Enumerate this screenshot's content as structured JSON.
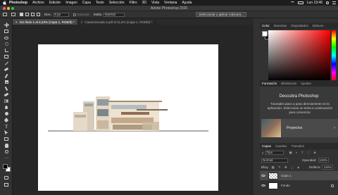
{
  "menubar": {
    "app": "Photoshop",
    "items": [
      "Archivo",
      "Edición",
      "Imagen",
      "Capa",
      "Texto",
      "Selección",
      "Filtro",
      "3D",
      "Vista",
      "Ventana",
      "Ayuda"
    ],
    "clock": "Lun 13:46"
  },
  "window": {
    "title": "Adobe Photoshop 2020"
  },
  "options": {
    "feather_label": "Des.:",
    "feather_value": "0 px",
    "antialias_label": "Suavizar",
    "style_label": "Estilo:",
    "style_value": "Normal",
    "select_mask_button": "Seleccionar y aplicar máscara..."
  },
  "doc_tabs": [
    {
      "label": "Sin título-1 al 8,33% (Capa 1, RGB/8) *",
      "active": true
    },
    {
      "label": "CasaCascada-2.pdf al 11,6% (Capa 1, RGB/8) *",
      "active": false
    }
  ],
  "color_panel": {
    "tabs": [
      "Color",
      "Muestras",
      "Degradados",
      "Motivos"
    ],
    "hue_color": "#ff0000"
  },
  "learn_panel": {
    "tabs": [
      "Formación",
      "Bibliotecas",
      "Ajustes"
    ],
    "title": "Descubra Photoshop",
    "description": "Tutoriales paso a paso directamente en la aplicación. Seleccione un tema a continuación para comenzar.",
    "card_label": "Proyectos"
  },
  "layers_panel": {
    "tabs": [
      "Capas",
      "Canales",
      "Trazados"
    ],
    "filter_value": "Tipo",
    "blend_mode": "Normal",
    "opacity_label": "Opacidad:",
    "opacity_value": "100%",
    "lock_label": "Bloq.:",
    "fill_label": "Relleno:",
    "fill_value": "100%",
    "layers": [
      {
        "name": "Capa 1"
      },
      {
        "name": "Fondo"
      }
    ]
  }
}
